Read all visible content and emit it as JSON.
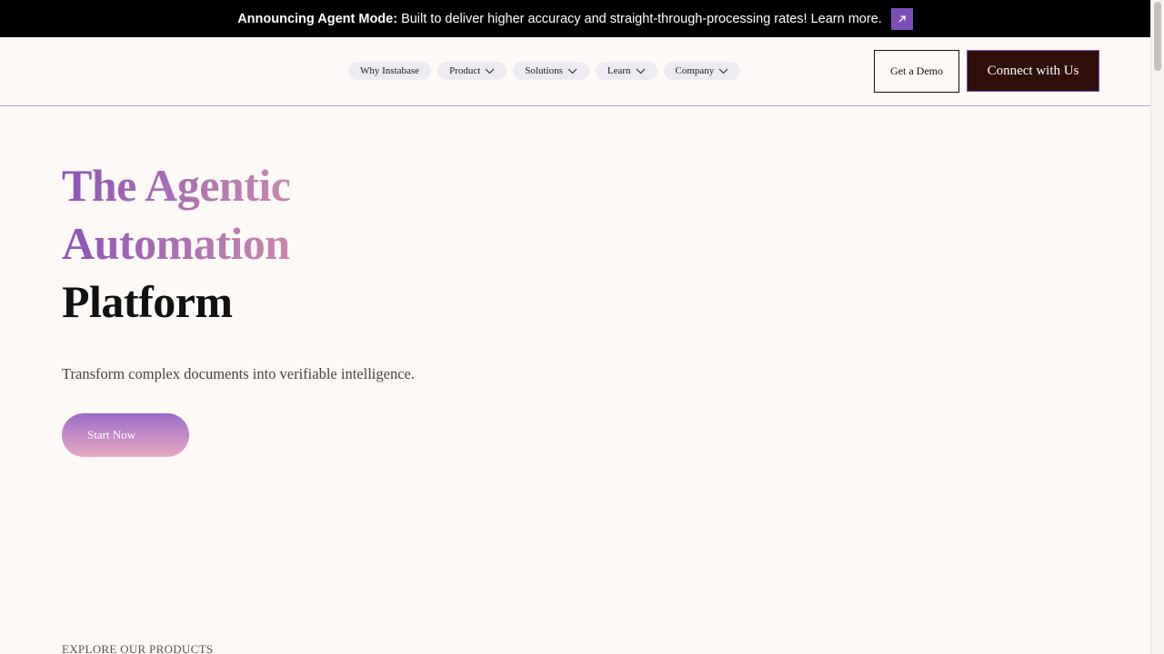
{
  "announcement": {
    "bold": "Announcing Agent Mode:",
    "text": "Built to deliver higher accuracy and straight-through-processing rates! Learn more.",
    "arrow_icon": "arrow-up-right-icon"
  },
  "nav": {
    "items": [
      {
        "label": "Why Instabase",
        "has_dropdown": false
      },
      {
        "label": "Product",
        "has_dropdown": true
      },
      {
        "label": "Solutions",
        "has_dropdown": true
      },
      {
        "label": "Learn",
        "has_dropdown": true
      },
      {
        "label": "Company",
        "has_dropdown": true
      }
    ],
    "demo_button": "Get a Demo",
    "connect_button": "Connect with Us"
  },
  "hero": {
    "title_line1": "The Agentic",
    "title_line2": "Automation",
    "title_line3": "Platform",
    "subtitle": "Transform complex documents into verifiable intelligence.",
    "cta": "Start Now"
  },
  "products": {
    "heading": "EXPLORE OUR PRODUCTS"
  },
  "colors": {
    "accent": "#7c4fb8",
    "dark_button": "#2e0f0a",
    "background": "#fdf9f6"
  }
}
